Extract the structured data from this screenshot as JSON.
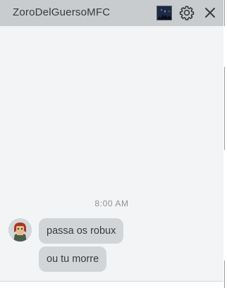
{
  "header": {
    "title": "ZoroDelGuersoMFC",
    "avatar_icon": "user-thumbnail",
    "settings_icon": "gear-icon",
    "close_icon": "close-icon"
  },
  "conversation": {
    "timestamp": "8:00 AM",
    "messages": [
      {
        "text": "passa os robux"
      },
      {
        "text": "ou tu morre"
      }
    ]
  },
  "colors": {
    "header_bg": "#c9cccf",
    "chat_bg": "#f2f4f5",
    "bubble_bg": "#d2d5d8",
    "text": "#393b3d"
  }
}
